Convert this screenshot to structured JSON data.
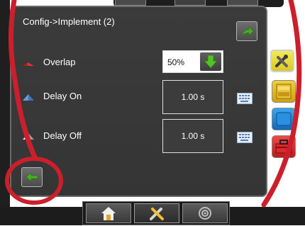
{
  "screen": {
    "title": "Config->Implement (2)"
  },
  "rows": {
    "overlap": {
      "label": "Overlap",
      "value": "50%"
    },
    "delay_on": {
      "label": "Delay On",
      "value": "1.00 s"
    },
    "delay_off": {
      "label": "Delay Off",
      "value": "1.00 s"
    }
  },
  "icons": {
    "next": "green-forward-arrow-icon",
    "back": "green-back-arrow-icon",
    "dropdown": "green-down-arrow-icon",
    "keyboard": "keyboard-icon"
  },
  "side_tabs": [
    "tools-tab",
    "yellow-tab",
    "blue-tab",
    "red-toolbox-tab"
  ],
  "bottom_nav": [
    "home",
    "tools",
    "gps"
  ],
  "colors": {
    "accent_green": "#48b023",
    "highlight_red": "#cc1f2b",
    "panel": "#373737"
  }
}
